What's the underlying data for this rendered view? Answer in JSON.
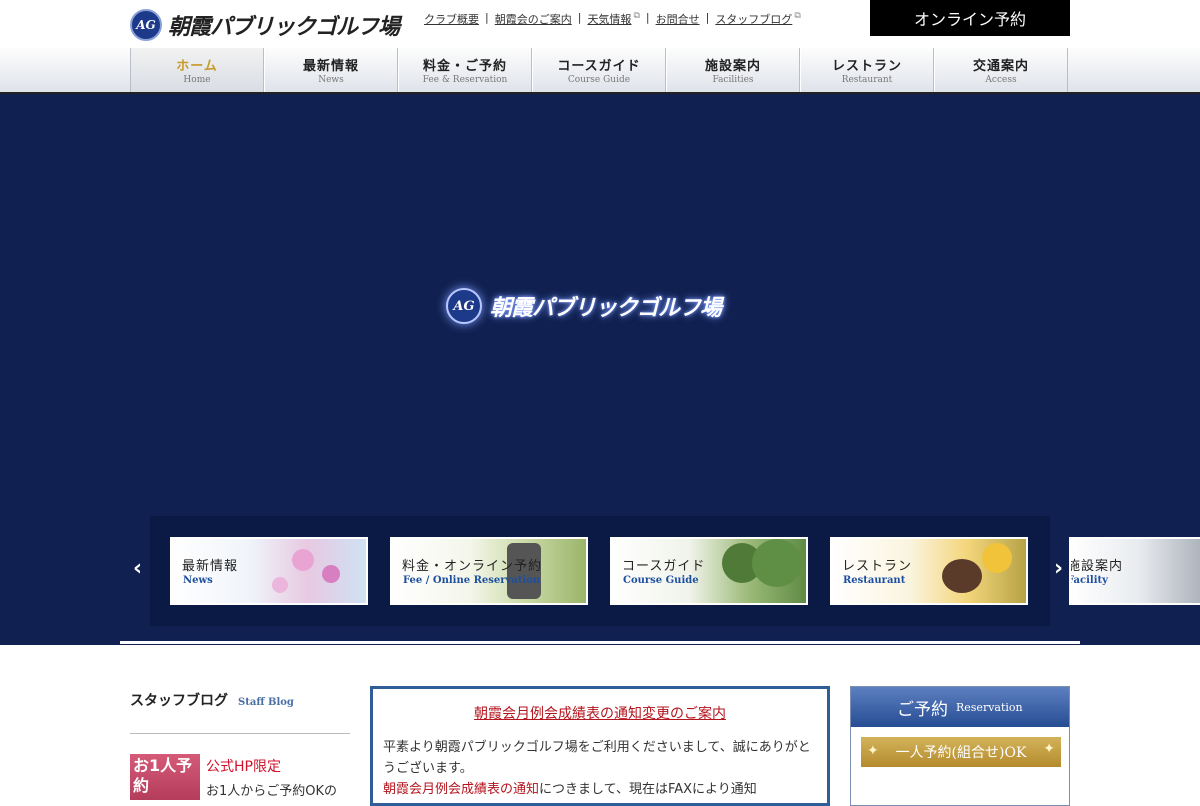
{
  "header": {
    "logo_mark": "AG",
    "logo_text": "朝霞パブリックゴルフ場",
    "top_links": [
      {
        "label": "クラブ概要",
        "external": false
      },
      {
        "label": "朝霞会のご案内",
        "external": false
      },
      {
        "label": "天気情報",
        "external": true
      },
      {
        "label": "お問合せ",
        "external": false
      },
      {
        "label": "スタッフブログ",
        "external": true
      }
    ],
    "online_reservation": "オンライン予約"
  },
  "nav": {
    "items": [
      {
        "jp": "ホーム",
        "en": "Home",
        "active": true
      },
      {
        "jp": "最新情報",
        "en": "News"
      },
      {
        "jp": "料金・ご予約",
        "en": "Fee & Reservation"
      },
      {
        "jp": "コースガイド",
        "en": "Course Guide"
      },
      {
        "jp": "施設案内",
        "en": "Facilities"
      },
      {
        "jp": "レストラン",
        "en": "Restaurant"
      },
      {
        "jp": "交通案内",
        "en": "Access"
      }
    ]
  },
  "hero": {
    "logo_mark": "AG",
    "logo_text": "朝霞パブリックゴルフ場",
    "arrow_left": "‹",
    "arrow_right": "›",
    "cards": [
      {
        "jp": "最新情報",
        "en": "News"
      },
      {
        "jp": "料金・オンライン予約",
        "en": "Fee / Online Reservation"
      },
      {
        "jp": "コースガイド",
        "en": "Course Guide"
      },
      {
        "jp": "レストラン",
        "en": "Restaurant"
      },
      {
        "jp": "施設案内",
        "en": "Facility"
      }
    ]
  },
  "blog": {
    "title": "スタッフブログ",
    "title_en": "Staff Blog",
    "thumb_text": "お1人予約",
    "post_title": "公式HP限定",
    "post_sub": "お1人からご予約OKの"
  },
  "notice": {
    "title": "朝霞会月例会成績表の通知変更のご案内",
    "body_1": "平素より朝霞パブリックゴルフ場をご利用くださいまして、誠にありがとうございます。",
    "body_link": "朝霞会月例会成績表の通知",
    "body_2": "につきまして、現在はFAXにより通知"
  },
  "reservation": {
    "title": "ご予約",
    "title_en": "Reservation",
    "button": "一人予約(組合せ)OK"
  },
  "colors": {
    "hero_bg": "#102050",
    "nav_active": "#c79a2a",
    "accent_red": "#b4151e",
    "reservation_blue": "#274d94",
    "gold": "#b48b2d"
  }
}
